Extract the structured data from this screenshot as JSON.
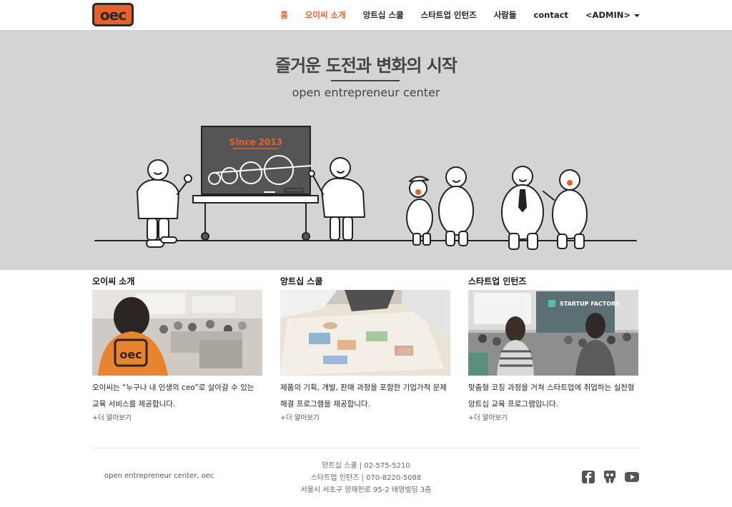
{
  "brand": {
    "logo_text": "oec"
  },
  "nav": {
    "items": [
      {
        "label": "홈"
      },
      {
        "label": "오이씨 소개"
      },
      {
        "label": "앙트십 스쿨"
      },
      {
        "label": "스타트업 인턴즈"
      },
      {
        "label": "사람들"
      },
      {
        "label": "contact"
      },
      {
        "label": "<ADMIN>"
      }
    ]
  },
  "hero": {
    "title": "즐거운 도전과 변화의 시작",
    "subtitle": "open entrepreneur center",
    "board_text": "Since 2013"
  },
  "sections": [
    {
      "heading": "오이씨 소개",
      "text": "오이씨는 “누구나 내 인생의 ceo”로 살아갈 수 있는 교육 서비스를 제공합니다.",
      "more": "+더 알아보기",
      "photo_shirt": "oec"
    },
    {
      "heading": "앙트십 스쿨",
      "text": "제품의 기획, 개발, 판매 과정을 포함한 기업가적 문제해결 프로그램을 제공합니다.",
      "more": "+더 알아보기"
    },
    {
      "heading": "스타트업 인턴즈",
      "text": "맞춤형 코칭 과정을 거쳐 스타트업에 취업하는 실천형 앙트십 교육 프로그램입니다.",
      "more": "+더 알아보기",
      "photo_screen": "STARTUP FACTORY"
    }
  ],
  "footer": {
    "left": "open entrepreneur center, oec",
    "lines": [
      "앙트십 스쿨 | 02-575-5210",
      "스타트업 인턴즈 | 070-8220-5088",
      "서울시 서초구 양재천로 95-2 태영빌딩 3층"
    ],
    "social": [
      "facebook-icon",
      "slideshare-icon",
      "youtube-icon"
    ]
  },
  "colors": {
    "accent": "#e8612c",
    "hero_bg": "#d4d4d4",
    "board": "#555555"
  }
}
